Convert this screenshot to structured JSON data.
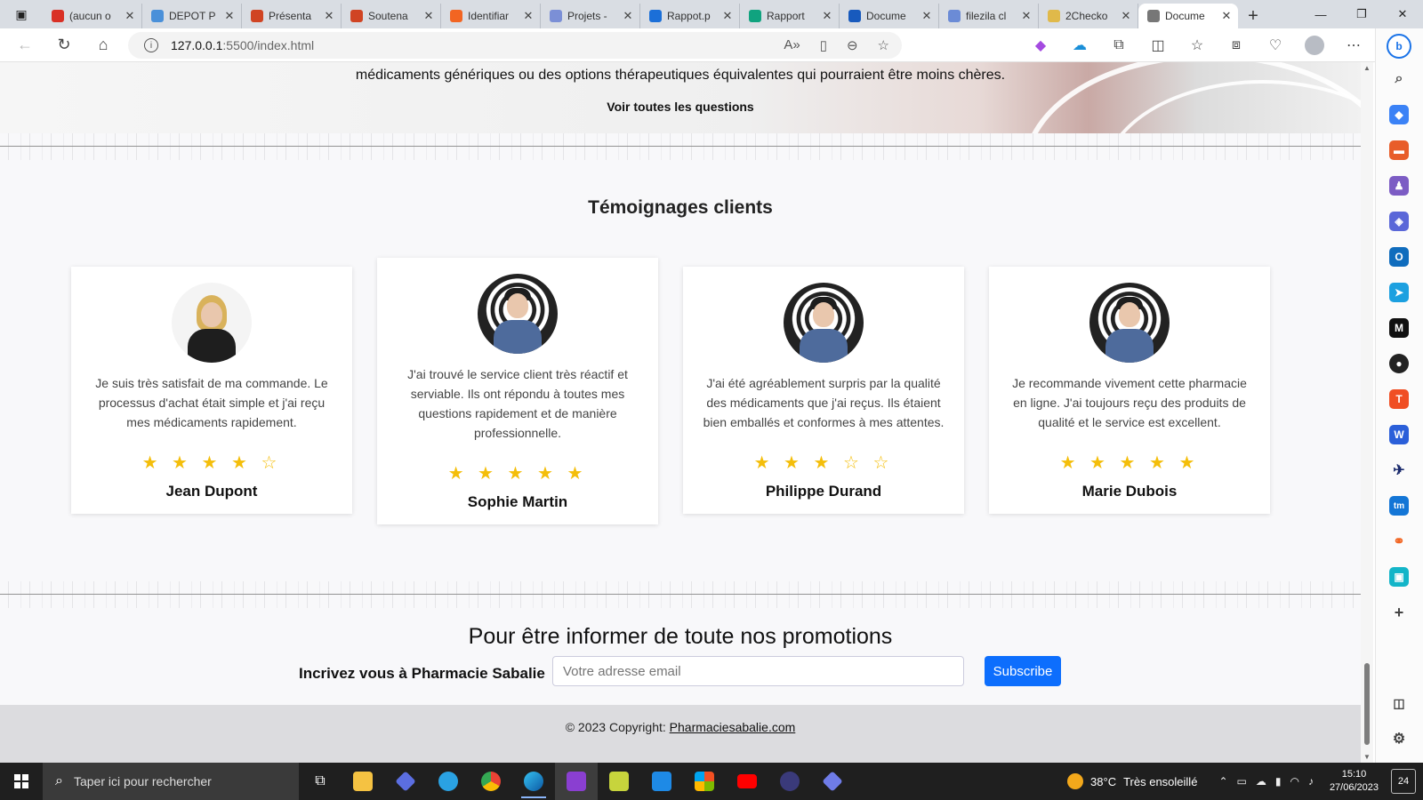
{
  "browser": {
    "tabs": [
      {
        "label": "(aucun o",
        "icon": "gmail-icon",
        "color": "#d93025"
      },
      {
        "label": "DEPOT P",
        "icon": "contact-icon",
        "color": "#4a90d9"
      },
      {
        "label": "Présenta",
        "icon": "powerpoint-icon",
        "color": "#d04423"
      },
      {
        "label": "Soutena",
        "icon": "powerpoint-icon",
        "color": "#d04423"
      },
      {
        "label": "Identifiar",
        "icon": "link-icon",
        "color": "#f26522"
      },
      {
        "label": "Projets -",
        "icon": "canva-icon",
        "color": "#7b8fd6"
      },
      {
        "label": "Rappot.p",
        "icon": "canva-icon",
        "color": "#1b6fd8"
      },
      {
        "label": "Rapport",
        "icon": "chatgpt-icon",
        "color": "#10a37f"
      },
      {
        "label": "Docume",
        "icon": "word-icon",
        "color": "#185abd"
      },
      {
        "label": "filezila cl",
        "icon": "search-icon",
        "color": "#6b8bd6"
      },
      {
        "label": "2Checko",
        "icon": "bag-icon",
        "color": "#e0b94a"
      },
      {
        "label": "Docume",
        "icon": "page-icon",
        "color": "#777777",
        "active": true
      }
    ],
    "url_host": "127.0.0.1",
    "url_path": ":5500/index.html"
  },
  "page": {
    "hero_question": "médicaments génériques ou des options thérapeutiques équivalentes qui pourraient être moins chères.",
    "hero_link": "Voir toutes les questions",
    "testimonials_title": "Témoignages clients",
    "testimonials": [
      {
        "quote": "Je suis très satisfait de ma commande. Le processus d'achat était simple et j'ai reçu mes médicaments rapidement.",
        "stars": "★ ★ ★ ★ ☆",
        "rating": 4,
        "name": "Jean Dupont",
        "photo": "woman"
      },
      {
        "quote": "J'ai trouvé le service client très réactif et serviable. Ils ont répondu à toutes mes questions rapidement et de manière professionnelle.",
        "stars": "★ ★ ★ ★ ★",
        "rating": 5,
        "name": "Sophie Martin",
        "photo": "man"
      },
      {
        "quote": "J'ai été agréablement surpris par la qualité des médicaments que j'ai reçus. Ils étaient bien emballés et conformes à mes attentes.",
        "stars": "★ ★ ★ ☆ ☆",
        "rating": 3,
        "name": "Philippe Durand",
        "photo": "man"
      },
      {
        "quote": "Je recommande vivement cette pharmacie en ligne. J'ai toujours reçu des produits de qualité et le service est excellent.",
        "stars": "★ ★ ★ ★ ★",
        "rating": 5,
        "name": "Marie Dubois",
        "photo": "man"
      }
    ],
    "promo_title": "Pour être informer de toute nos promotions",
    "promo_label": "Incrivez vous à Pharmacie Sabalie",
    "email_placeholder": "Votre adresse email",
    "subscribe_label": "Subscribe",
    "footer_prefix": "© 2023 Copyright: ",
    "footer_link": "Pharmaciesabalie.com"
  },
  "taskbar": {
    "search_placeholder": "Taper ici pour rechercher",
    "temperature": "38°C",
    "weather_text": "Très ensoleillé",
    "time": "15:10",
    "date": "27/06/2023",
    "notifications": "24"
  },
  "colors": {
    "accent": "#0d6efd",
    "star": "#f4be0a"
  }
}
